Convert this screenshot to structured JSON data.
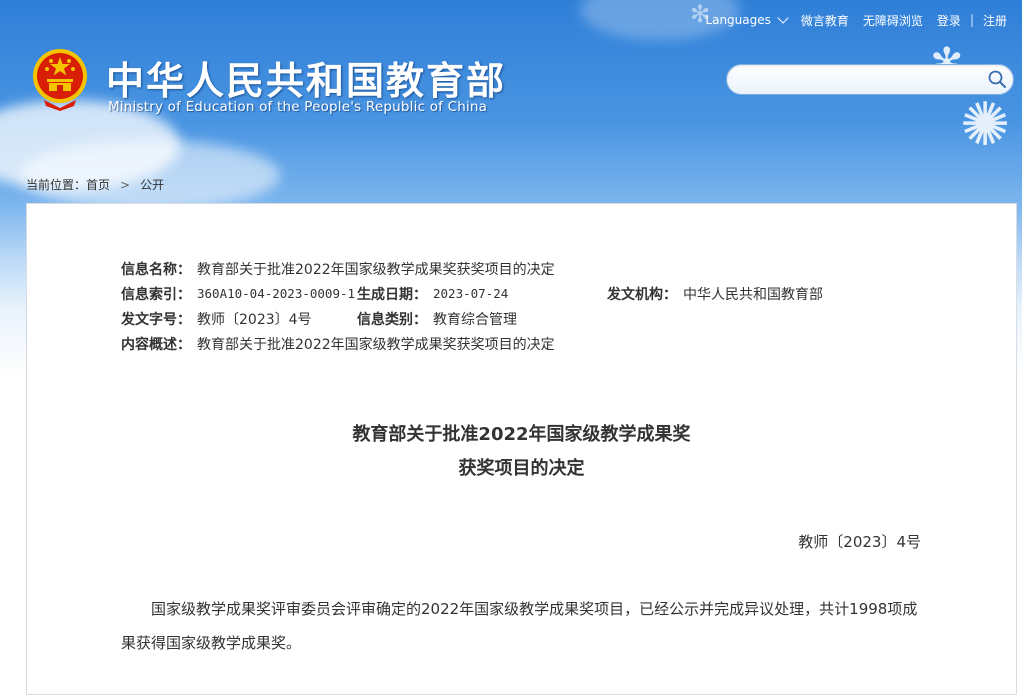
{
  "topbar": {
    "languages": "Languages",
    "wechat": "微言教育",
    "accessibility": "无障碍浏览",
    "login": "登录",
    "divider": "|",
    "register": "注册"
  },
  "header": {
    "title": "中华人民共和国教育部",
    "subtitle": "Ministry of Education of the People's Republic of China"
  },
  "search": {
    "placeholder": ""
  },
  "breadcrumb": {
    "label": "当前位置：",
    "home": "首页",
    "separator": ">",
    "current": "公开"
  },
  "meta": {
    "info_name_label": "信息名称：",
    "info_name": "教育部关于批准2022年国家级教学成果奖获奖项目的决定",
    "index_label": "信息索引：",
    "index": "360A10-04-2023-0009-1",
    "date_label": "生成日期：",
    "date": "2023-07-24",
    "issuer_label": "发文机构：",
    "issuer": "中华人民共和国教育部",
    "docno_label": "发文字号：",
    "docno": "教师〔2023〕4号",
    "category_label": "信息类别：",
    "category": "教育综合管理",
    "summary_label": "内容概述：",
    "summary": "教育部关于批准2022年国家级教学成果奖获奖项目的决定"
  },
  "article": {
    "title_line1": "教育部关于批准2022年国家级教学成果奖",
    "title_line2": "获奖项目的决定",
    "doc_number": "教师〔2023〕4号",
    "paragraph1": "国家级教学成果奖评审委员会评审确定的2022年国家级教学成果奖项目，已经公示并完成异议处理，共计1998项成果获得国家级教学成果奖。"
  },
  "colors": {
    "header_blue": "#2f7fd8",
    "text": "#333333",
    "emblem_red": "#d81e06",
    "emblem_gold": "#f5c400"
  }
}
